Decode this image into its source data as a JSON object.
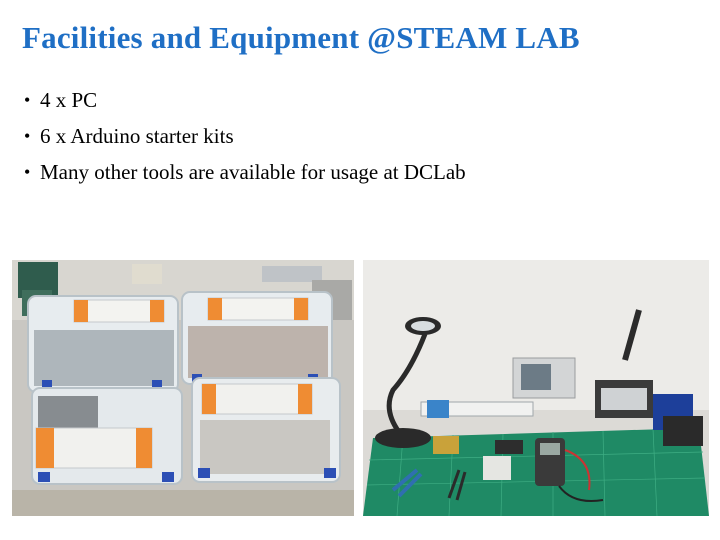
{
  "slide": {
    "title": "Facilities and Equipment @STEAM LAB",
    "title_color": "#1f6fc5",
    "bullet_glyph": "•",
    "bullets": [
      "4 x PC",
      "6 x Arduino starter kits",
      "Many other tools are available for usage at DCLab"
    ]
  },
  "photos": [
    {
      "name": "arduino-kits-photo",
      "depicts": "stacked clear plastic boxes of Arduino starter kits"
    },
    {
      "name": "lab-workbench-photo",
      "depicts": "green cutting mat with magnifier lamp, oscilloscope, soldering station, multimeter and tools"
    }
  ]
}
